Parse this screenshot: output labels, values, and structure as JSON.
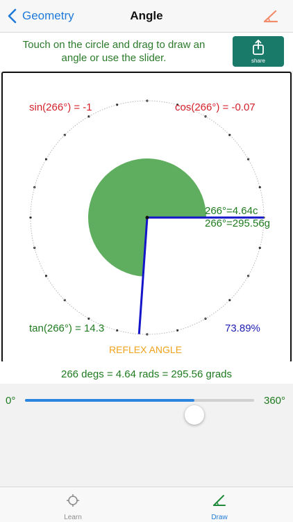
{
  "nav": {
    "back_label": "Geometry",
    "title": "Angle",
    "action_icon": "angle-icon"
  },
  "instruction": "Touch on the circle and drag to draw an angle or use the slider.",
  "share": {
    "label": "share",
    "icon": "share-icon"
  },
  "angle": {
    "degrees": 266,
    "sin_text": "sin(266°) = -1",
    "cos_text": "cos(266°) = -0.07",
    "tan_text": "tan(266°) = 14.3",
    "circ_text": "266°=4.64c",
    "grad_text": "266°=295.56g",
    "percent_text": "73.89%",
    "type_text": "REFLEX ANGLE"
  },
  "summary": "266 degs = 4.64 rads = 295.56 grads",
  "slider": {
    "min_label": "0°",
    "max_label": "360°",
    "value": 266,
    "max": 360
  },
  "tabs": [
    {
      "label": "Learn",
      "icon": "crosshair-icon",
      "active": false
    },
    {
      "label": "Draw",
      "icon": "draw-icon",
      "active": true
    }
  ],
  "colors": {
    "accent": "#1f7ad8",
    "green_text": "#1f7a1f",
    "red_text": "#d41f2a",
    "sector": "#5fae5f",
    "ray": "#1414c8",
    "share_bg": "#1a7a6a",
    "angle_type": "#f0a21a"
  }
}
